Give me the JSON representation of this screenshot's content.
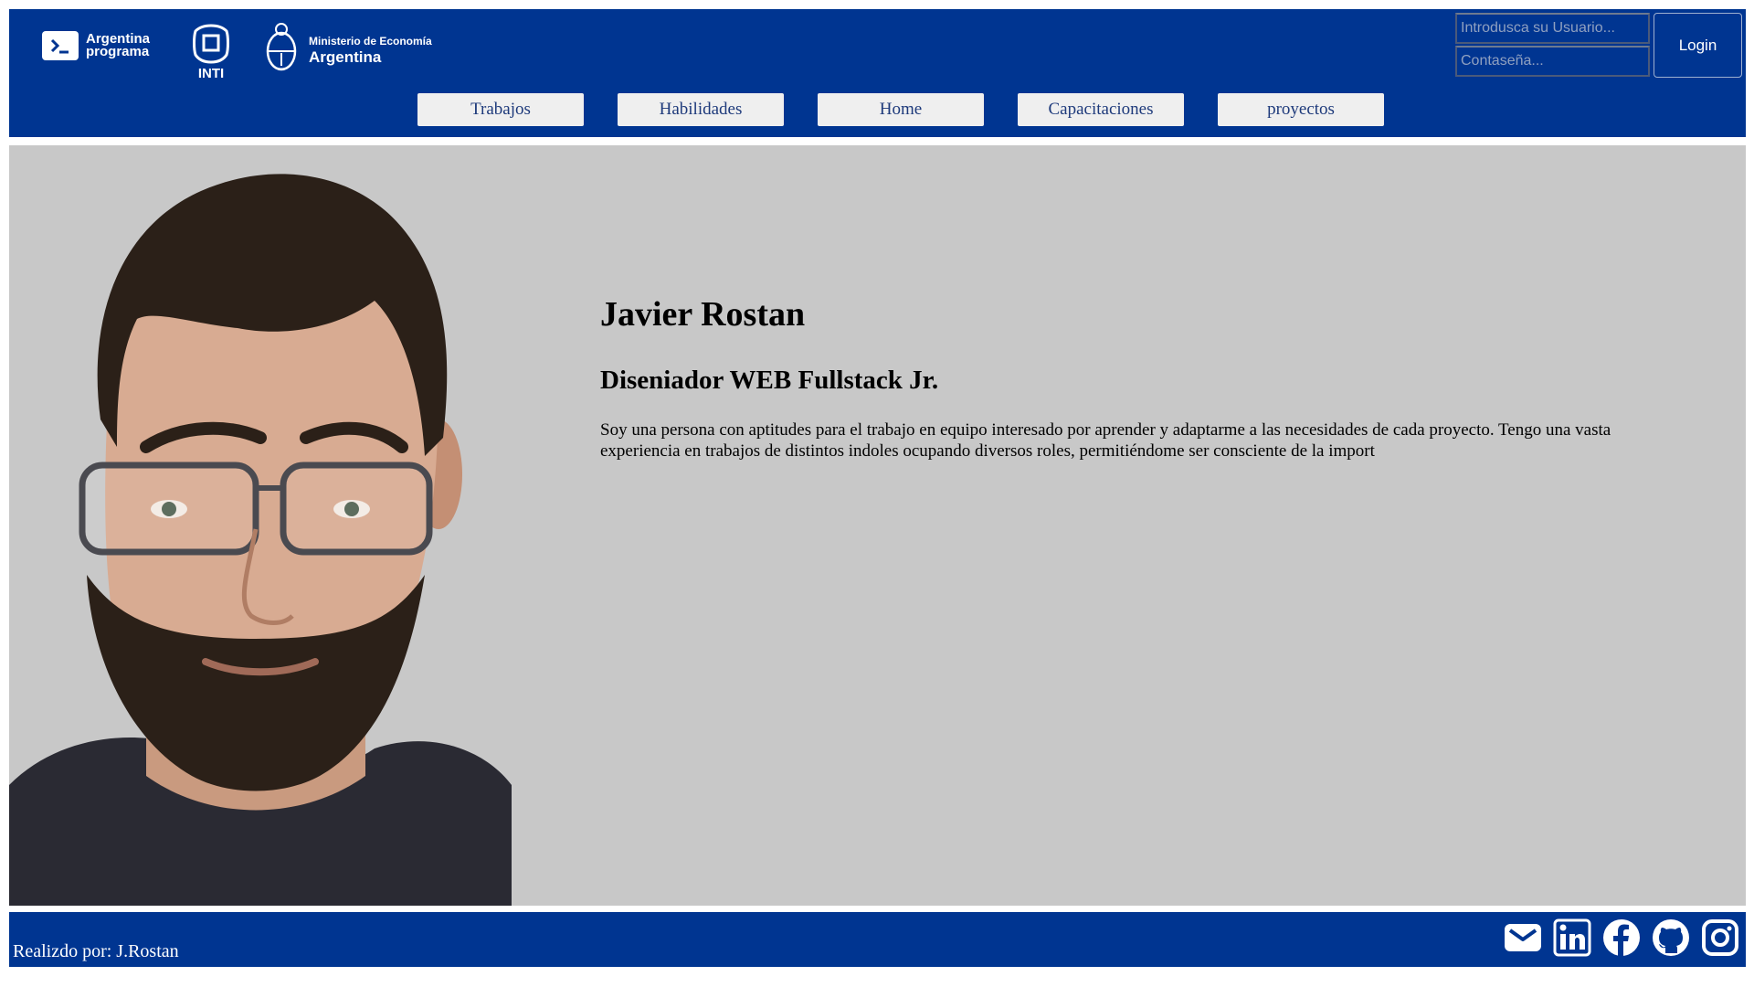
{
  "header": {
    "logos": {
      "argentina_programa": "Argentina programa",
      "inti": "INTI",
      "ministerio_line1": "Ministerio de Economía",
      "ministerio_line2": "Argentina"
    },
    "login": {
      "user_placeholder": "Introdusca su Usuario...",
      "password_placeholder": "Contaseña...",
      "button_label": "Login"
    },
    "nav": [
      "Trabajos",
      "Habilidades",
      "Home",
      "Capacitaciones",
      "proyectos"
    ]
  },
  "profile": {
    "name": "Javier Rostan",
    "title": "Diseniador WEB Fullstack Jr.",
    "description": "Soy una persona con aptitudes para el trabajo en equipo interesado por aprender y adaptarme a las necesidades de cada proyecto. Tengo una vasta experiencia en trabajos de distintos indoles ocupando diversos roles, permitiéndome ser consciente de la import"
  },
  "footer": {
    "credit": "Realizdo por: J.Rostan",
    "social_icons": [
      "mail-icon",
      "linkedin-icon",
      "facebook-icon",
      "github-icon",
      "instagram-icon"
    ]
  },
  "colors": {
    "brand_blue": "#003591",
    "main_bg": "#c8c8c8",
    "nav_button_bg": "#efefef",
    "nav_text": "#1e3a7b"
  }
}
